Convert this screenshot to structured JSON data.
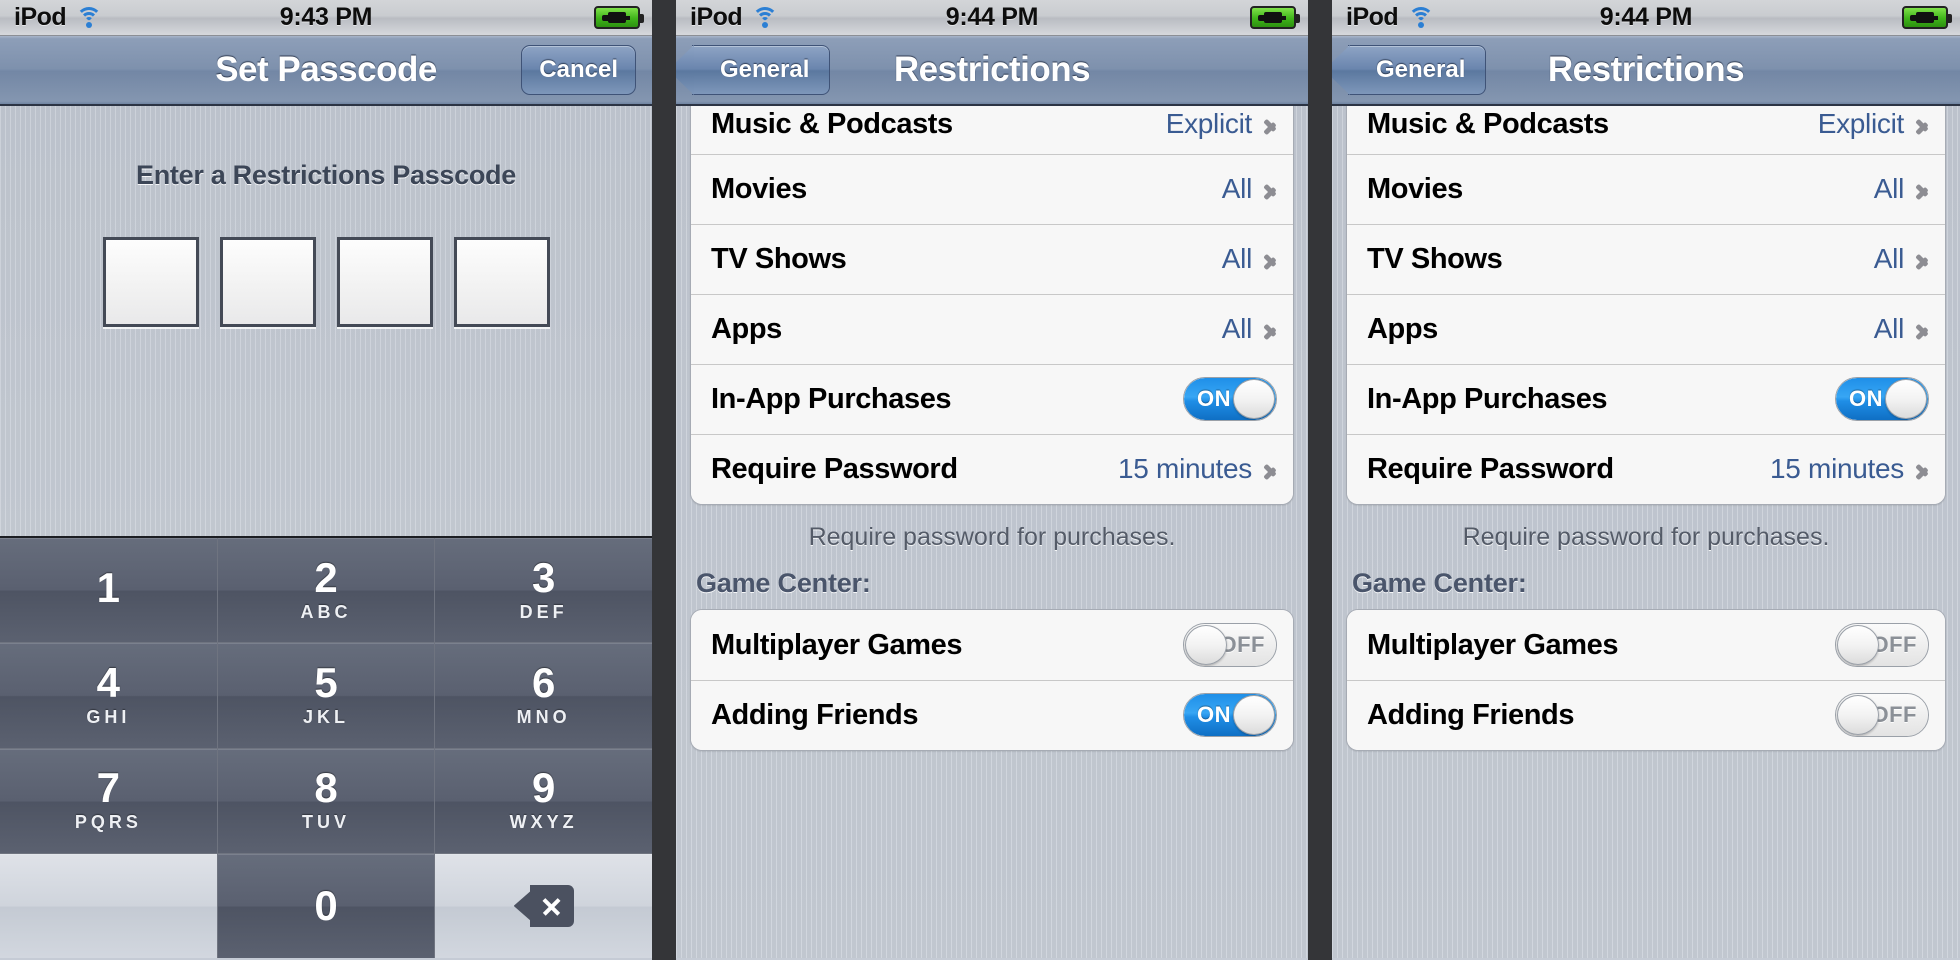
{
  "panels": [
    {
      "status": {
        "carrier": "iPod",
        "time": "9:43 PM",
        "wifi_icon": "wifi-icon",
        "battery_icon": "battery-charging-icon"
      },
      "nav": {
        "title": "Set Passcode",
        "cancel_label": "Cancel"
      },
      "passcode": {
        "prompt": "Enter a Restrictions Passcode",
        "digits": [
          "",
          "",
          "",
          ""
        ]
      },
      "keypad": [
        {
          "num": "1",
          "letters": ""
        },
        {
          "num": "2",
          "letters": "ABC"
        },
        {
          "num": "3",
          "letters": "DEF"
        },
        {
          "num": "4",
          "letters": "GHI"
        },
        {
          "num": "5",
          "letters": "JKL"
        },
        {
          "num": "6",
          "letters": "MNO"
        },
        {
          "num": "7",
          "letters": "PQRS"
        },
        {
          "num": "8",
          "letters": "TUV"
        },
        {
          "num": "9",
          "letters": "WXYZ"
        },
        {
          "num": "",
          "letters": ""
        },
        {
          "num": "0",
          "letters": ""
        },
        {
          "num": "delete-icon",
          "letters": ""
        }
      ]
    },
    {
      "status": {
        "carrier": "iPod",
        "time": "9:44 PM",
        "wifi_icon": "wifi-icon",
        "battery_icon": "battery-charging-icon"
      },
      "nav": {
        "back_label": "General",
        "title": "Restrictions"
      },
      "rows": [
        {
          "label": "Music & Podcasts",
          "value": "Explicit",
          "type": "disclosure"
        },
        {
          "label": "Movies",
          "value": "All",
          "type": "disclosure"
        },
        {
          "label": "TV Shows",
          "value": "All",
          "type": "disclosure"
        },
        {
          "label": "Apps",
          "value": "All",
          "type": "disclosure"
        },
        {
          "label": "In-App Purchases",
          "value": "ON",
          "type": "switch",
          "state": "on"
        },
        {
          "label": "Require Password",
          "value": "15 minutes",
          "type": "disclosure"
        }
      ],
      "footnote": "Require password for purchases.",
      "section_header": "Game Center:",
      "game_center_rows": [
        {
          "label": "Multiplayer Games",
          "value": "OFF",
          "type": "switch",
          "state": "off"
        },
        {
          "label": "Adding Friends",
          "value": "ON",
          "type": "switch",
          "state": "on"
        }
      ]
    },
    {
      "status": {
        "carrier": "iPod",
        "time": "9:44 PM",
        "wifi_icon": "wifi-icon",
        "battery_icon": "battery-charging-icon"
      },
      "nav": {
        "back_label": "General",
        "title": "Restrictions"
      },
      "rows": [
        {
          "label": "Music & Podcasts",
          "value": "Explicit",
          "type": "disclosure"
        },
        {
          "label": "Movies",
          "value": "All",
          "type": "disclosure"
        },
        {
          "label": "TV Shows",
          "value": "All",
          "type": "disclosure"
        },
        {
          "label": "Apps",
          "value": "All",
          "type": "disclosure"
        },
        {
          "label": "In-App Purchases",
          "value": "ON",
          "type": "switch",
          "state": "on"
        },
        {
          "label": "Require Password",
          "value": "15 minutes",
          "type": "disclosure"
        }
      ],
      "footnote": "Require password for purchases.",
      "section_header": "Game Center:",
      "game_center_rows": [
        {
          "label": "Multiplayer Games",
          "value": "OFF",
          "type": "switch",
          "state": "off"
        },
        {
          "label": "Adding Friends",
          "value": "OFF",
          "type": "switch",
          "state": "off"
        }
      ]
    }
  ],
  "colors": {
    "accent_blue": "#1f8fe8",
    "value_blue": "#3a5b92",
    "navbar_blue": "#7387a5",
    "chevron_gray": "#8d8d93",
    "battery_green": "#3fb41a"
  }
}
